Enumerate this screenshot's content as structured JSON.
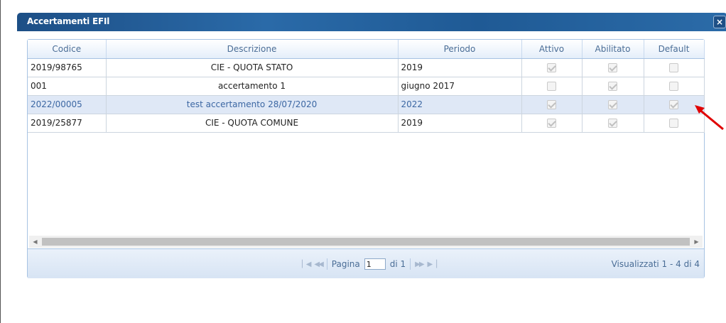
{
  "window": {
    "title": "Accertamenti EFIl",
    "close_label": "×"
  },
  "grid": {
    "columns": [
      "Codice",
      "Descrizione",
      "Periodo",
      "Attivo",
      "Abilitato",
      "Default"
    ],
    "rows": [
      {
        "codice": "2019/98765",
        "descrizione": "CIE - QUOTA STATO",
        "periodo": "2019",
        "attivo": true,
        "abilitato": true,
        "default": false,
        "selected": false
      },
      {
        "codice": "001",
        "descrizione": "accertamento 1",
        "periodo": "giugno 2017",
        "attivo": false,
        "abilitato": true,
        "default": false,
        "selected": false
      },
      {
        "codice": "2022/00005",
        "descrizione": "test accertamento 28/07/2020",
        "periodo": "2022",
        "attivo": true,
        "abilitato": true,
        "default": true,
        "selected": true
      },
      {
        "codice": "2019/25877",
        "descrizione": "CIE - QUOTA COMUNE",
        "periodo": "2019",
        "attivo": true,
        "abilitato": true,
        "default": false,
        "selected": false
      }
    ]
  },
  "pager": {
    "page_label": "Pagina",
    "page_value": "1",
    "of_label": "di 1",
    "status": "Visualizzati 1 - 4 di 4"
  },
  "colors": {
    "titlebar": "#1d4f86",
    "selected_row": "#dfe8f6",
    "annotation_arrow": "#e00000"
  }
}
